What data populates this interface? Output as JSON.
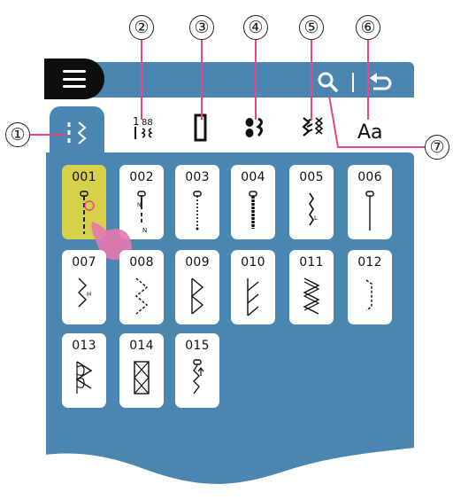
{
  "callouts": [
    "①",
    "②",
    "③",
    "④",
    "⑤",
    "⑥",
    "⑦"
  ],
  "menu": {
    "icon": "hamburger-menu-icon"
  },
  "top_bar": {
    "search_icon": "search-icon",
    "back_icon": "back-arrow-icon"
  },
  "tabs": [
    {
      "icon": "utility-stitch-icon",
      "selected": true
    },
    {
      "icon": "character-decorative-stitch-icon"
    },
    {
      "icon": "buttonhole-icon"
    },
    {
      "icon": "eyelet-stitch-icon"
    },
    {
      "icon": "decorative-stitch-icon"
    },
    {
      "label": "Aa"
    }
  ],
  "stitches": [
    {
      "num": "001",
      "selected": true
    },
    {
      "num": "002",
      "mark": "N"
    },
    {
      "num": "003"
    },
    {
      "num": "004"
    },
    {
      "num": "005",
      "mark": "L"
    },
    {
      "num": "006"
    },
    {
      "num": "007",
      "mark": "M"
    },
    {
      "num": "008"
    },
    {
      "num": "009"
    },
    {
      "num": "010"
    },
    {
      "num": "011"
    },
    {
      "num": "012"
    },
    {
      "num": "013"
    },
    {
      "num": "014"
    },
    {
      "num": "015"
    }
  ],
  "colors": {
    "panel": "#4a86b0",
    "selected": "#d7d04a",
    "callout_line": "#e8458a"
  }
}
